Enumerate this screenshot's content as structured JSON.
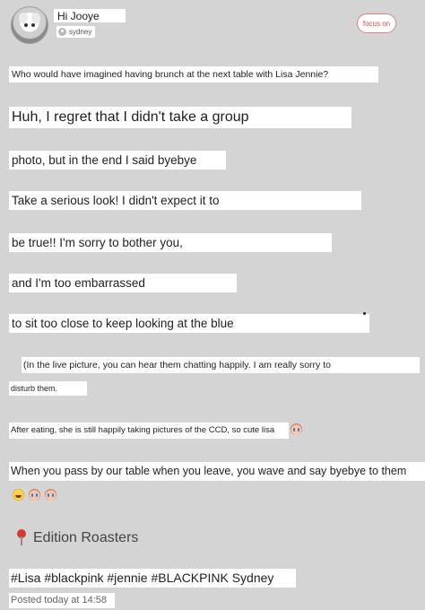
{
  "post": {
    "user": {
      "name": "Hi Jooye",
      "location": "sydney"
    },
    "follow_button": "focus on",
    "lines": [
      "Who would have imagined having brunch at the next table with Lisa Jennie?",
      "Huh, I regret that I didn't take a group",
      "photo, but in the end I said byebye",
      "Take a serious look! I didn't expect it to",
      "be true!! I'm sorry to bother you,",
      "and I'm too embarrassed",
      "to sit too close to keep looking at the blue",
      "(In the live picture, you can hear them chatting happily. I am really sorry to",
      "disturb them.",
      "After eating, she is still happily taking pictures of the CCD, so cute lisa",
      "When you pass by our table when you leave, you wave and say byebye to them"
    ],
    "location_tag": "Edition Roasters",
    "hashtags": "#Lisa #blackpink #jennie #BLACKPINK Sydney",
    "posted": "Posted today at 14:58",
    "emoji": [
      "crying-face",
      "crying-face",
      "laughing-face",
      "crying-face",
      "crying-face"
    ]
  },
  "colors": {
    "background": "#d4d4d4",
    "accent": "#d14a4a",
    "pin": "#d33a2c"
  }
}
